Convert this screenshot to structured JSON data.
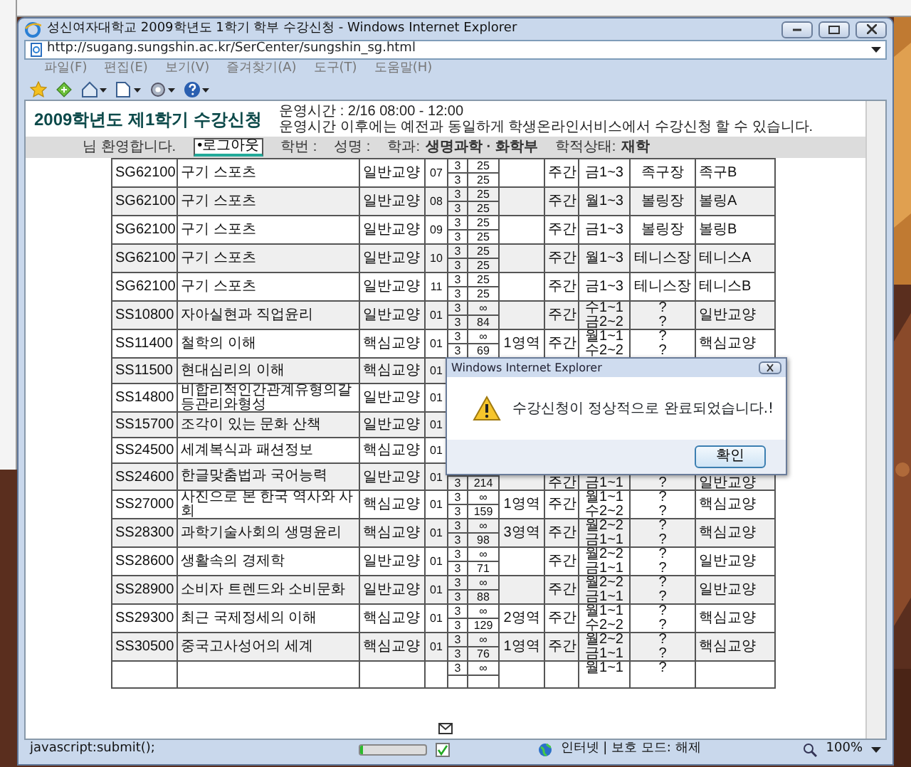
{
  "window": {
    "title": "성신여자대학교 2009학년도 1학기 학부 수강신청 - Windows Internet Explorer",
    "url": "http://sugang.sungshin.ac.kr/SerCenter/sungshin_sg.html"
  },
  "menu": [
    "파일(F)",
    "편집(E)",
    "보기(V)",
    "즐겨찾기(A)",
    "도구(T)",
    "도움말(H)"
  ],
  "page": {
    "title": "2009학년도 제1학기 수강신청",
    "hours": "운영시간 : 2/16 08:00 - 12:00",
    "hours_note": "운영시간 이후에는 예전과 동일하게 학생온라인서비스에서 수강신청 할 수 있습니다."
  },
  "user_bar": {
    "welcome": "님 환영합니다.",
    "logout": "•로그아웃",
    "fields": [
      {
        "label": "학번 :"
      },
      {
        "label": "성명 :"
      },
      {
        "label": "학과:",
        "value": "생명과학 · 화학부"
      },
      {
        "label": "학적상태:",
        "value": "재학"
      }
    ]
  },
  "table": {
    "rows": [
      {
        "code": "SG62100",
        "name": "구기 스포츠",
        "type": "일반교양",
        "section": "07",
        "credits": [
          "3",
          "3"
        ],
        "capacity": [
          "25",
          "25"
        ],
        "session": "주간",
        "time": [
          "금1~3"
        ],
        "room": [
          "족구장"
        ],
        "note": "족구B"
      },
      {
        "code": "SG62100",
        "name": "구기 스포츠",
        "type": "일반교양",
        "section": "08",
        "credits": [
          "3",
          "3"
        ],
        "capacity": [
          "25",
          "25"
        ],
        "session": "주간",
        "time": [
          "월1~3"
        ],
        "room": [
          "볼링장"
        ],
        "note": "볼링A"
      },
      {
        "code": "SG62100",
        "name": "구기 스포츠",
        "type": "일반교양",
        "section": "09",
        "credits": [
          "3",
          "3"
        ],
        "capacity": [
          "25",
          "25"
        ],
        "session": "주간",
        "time": [
          "금1~3"
        ],
        "room": [
          "볼링장"
        ],
        "note": "볼링B"
      },
      {
        "code": "SG62100",
        "name": "구기 스포츠",
        "type": "일반교양",
        "section": "10",
        "credits": [
          "3",
          "3"
        ],
        "capacity": [
          "25",
          "25"
        ],
        "session": "주간",
        "time": [
          "월1~3"
        ],
        "room": [
          "테니스장"
        ],
        "note": "테니스A"
      },
      {
        "code": "SG62100",
        "name": "구기 스포츠",
        "type": "일반교양",
        "section": "11",
        "credits": [
          "3",
          "3"
        ],
        "capacity": [
          "25",
          "25"
        ],
        "session": "주간",
        "time": [
          "금1~3"
        ],
        "room": [
          "테니스장"
        ],
        "note": "테니스B"
      },
      {
        "code": "SS10800",
        "name": "자아실현과 직업윤리",
        "type": "일반교양",
        "section": "01",
        "credits": [
          "3",
          "3"
        ],
        "capacity": [
          "∞",
          "84"
        ],
        "session": "주간",
        "time": [
          "수1~1",
          "금2~2"
        ],
        "room": [
          "?",
          "?"
        ],
        "note": "일반교양"
      },
      {
        "code": "SS11400",
        "name": "철학의 이해",
        "type": "핵심교양",
        "section": "01",
        "credits": [
          "3",
          "3"
        ],
        "capacity": [
          "∞",
          "69"
        ],
        "area": "1영역",
        "session": "주간",
        "time": [
          "월1~1",
          "수2~2"
        ],
        "room": [
          "?",
          "?"
        ],
        "note": "핵심교양"
      },
      {
        "code": "SS11500",
        "name": "현대심리의 이해",
        "type": "핵심교양",
        "section": "01"
      },
      {
        "code": "SS14800",
        "name": "비합리적인간관계유형의갈등관리와형성",
        "type": "일반교양",
        "section": "01"
      },
      {
        "code": "SS15700",
        "name": "조각이 있는 문화 산책",
        "type": "일반교양",
        "section": "01"
      },
      {
        "code": "SS24500",
        "name": "세계복식과 패션정보",
        "type": "핵심교양",
        "section": "01"
      },
      {
        "code": "SS24600",
        "name": "한글맞춤법과 국어능력",
        "type": "일반교양",
        "section": "01",
        "credits": [
          "3"
        ],
        "capacity": [
          "214"
        ],
        "session": "주간",
        "time": [
          "금1~1"
        ],
        "room": [
          "?"
        ],
        "note": "일반교양"
      },
      {
        "code": "SS27000",
        "name": "사진으로 본 한국 역사와 사회",
        "type": "핵심교양",
        "section": "01",
        "credits": [
          "3",
          "3"
        ],
        "capacity": [
          "∞",
          "159"
        ],
        "area": "1영역",
        "session": "주간",
        "time": [
          "월1~1",
          "수2~2"
        ],
        "room": [
          "?",
          "?"
        ],
        "note": "핵심교양"
      },
      {
        "code": "SS28300",
        "name": "과학기술사회의 생명윤리",
        "type": "핵심교양",
        "section": "01",
        "credits": [
          "3",
          "3"
        ],
        "capacity": [
          "∞",
          "98"
        ],
        "area": "3영역",
        "session": "주간",
        "time": [
          "월2~2",
          "금1~1"
        ],
        "room": [
          "?",
          "?"
        ],
        "note": "핵심교양"
      },
      {
        "code": "SS28600",
        "name": "생활속의 경제학",
        "type": "일반교양",
        "section": "01",
        "credits": [
          "3",
          "3"
        ],
        "capacity": [
          "∞",
          "71"
        ],
        "session": "주간",
        "time": [
          "월2~2",
          "금1~1"
        ],
        "room": [
          "?",
          "?"
        ],
        "note": "일반교양"
      },
      {
        "code": "SS28900",
        "name": "소비자 트렌드와 소비문화",
        "type": "일반교양",
        "section": "01",
        "credits": [
          "3",
          "3"
        ],
        "capacity": [
          "∞",
          "88"
        ],
        "session": "주간",
        "time": [
          "월2~2",
          "금1~1"
        ],
        "room": [
          "?",
          "?"
        ],
        "note": "일반교양"
      },
      {
        "code": "SS29300",
        "name": "최근 국제정세의 이해",
        "type": "핵심교양",
        "section": "01",
        "credits": [
          "3",
          "3"
        ],
        "capacity": [
          "∞",
          "129"
        ],
        "area": "2영역",
        "session": "주간",
        "time": [
          "월1~1",
          "수2~2"
        ],
        "room": [
          "?",
          "?"
        ],
        "note": "핵심교양"
      },
      {
        "code": "SS30500",
        "name": "중국고사성어의 세계",
        "type": "핵심교양",
        "section": "01",
        "credits": [
          "3",
          "3"
        ],
        "capacity": [
          "∞",
          "76"
        ],
        "area": "1영역",
        "session": "주간",
        "time": [
          "월2~2",
          "금1~1"
        ],
        "room": [
          "?",
          "?"
        ],
        "note": "핵심교양"
      },
      {
        "credits": [
          "3"
        ],
        "capacity": [
          "∞"
        ],
        "time": [
          "월1~1"
        ],
        "room": [
          "?"
        ]
      }
    ]
  },
  "dialog": {
    "title": "Windows Internet Explorer",
    "message": "수강신청이 정상적으로 완료되었습니다.!",
    "button": "확인"
  },
  "status_bar": {
    "text": "javascript:submit();",
    "progress": {
      "level": 0.04
    },
    "zone": "인터넷 | 보호 모드: 해제",
    "zoom": "100%"
  }
}
